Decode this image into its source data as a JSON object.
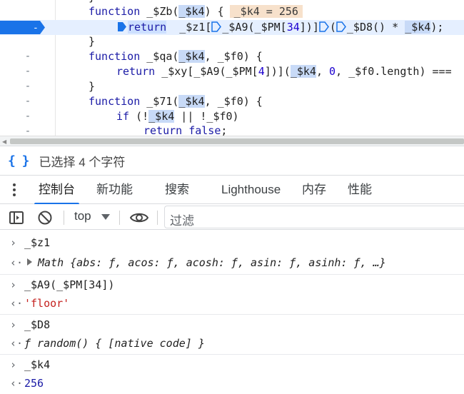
{
  "editor": {
    "lines": [
      {
        "gutter": "-",
        "parts": [
          [
            "fn-kw",
            "function"
          ],
          [
            "id",
            " _$Zb("
          ],
          [
            "sel",
            "_$k4"
          ],
          [
            "id",
            ") {"
          ]
        ],
        "inline": "_$k4 = 256"
      },
      {
        "gutter": "-",
        "current": true
      },
      {
        "gutter": "-",
        "text": "}"
      },
      {
        "gutter": "-",
        "text": "function _$qa(_$k4, _$f0) {"
      },
      {
        "gutter": "-",
        "text": "return _$xy[_$A9(_$PM[4])](_$k4, 0, _$f0.length) ==="
      },
      {
        "gutter": "-",
        "text": "}"
      },
      {
        "gutter": "-",
        "text": "function _$71(_$k4, _$f0) {"
      },
      {
        "gutter": "-",
        "text": "if (!_$k4 || !_$f0)"
      },
      {
        "gutter": "-",
        "text": "return false;"
      }
    ],
    "current_line": {
      "ret": "return",
      "fn": "_$z1[",
      "call1": "_$A9(_$PM[",
      "n34": "34",
      "close1": "])]",
      "paren": "(",
      "d8": "_$D8() * ",
      "k4": "_$k4",
      "end": ");"
    }
  },
  "status": {
    "braces_icon": "braces-icon",
    "text": "已选择 4 个字符"
  },
  "drawer": {
    "tabs": [
      "控制台",
      "新功能",
      "搜索",
      "Lighthouse",
      "内存",
      "性能"
    ],
    "active_tab": "控制台"
  },
  "toolbar": {
    "context": "top",
    "filter_placeholder": "过滤"
  },
  "console": {
    "entries": [
      {
        "type": "input",
        "text": "_$z1"
      },
      {
        "type": "output",
        "text": "Math {abs: ƒ, acos: ƒ, acosh: ƒ, asin: ƒ, asinh: ƒ, …}"
      },
      {
        "type": "input",
        "text": "_$A9(_$PM[34])"
      },
      {
        "type": "output",
        "text": "'floor'"
      },
      {
        "type": "input",
        "text": "_$D8"
      },
      {
        "type": "output",
        "text": "ƒ random() { [native code] }"
      },
      {
        "type": "input",
        "text": "_$k4"
      },
      {
        "type": "output",
        "text": "256"
      }
    ]
  },
  "colors": {
    "accent": "#1a73e8",
    "current_line_bg": "#e5efff",
    "string": "#c5221f",
    "number": "#1a1aa6",
    "keyword": "#1a1aa6"
  }
}
